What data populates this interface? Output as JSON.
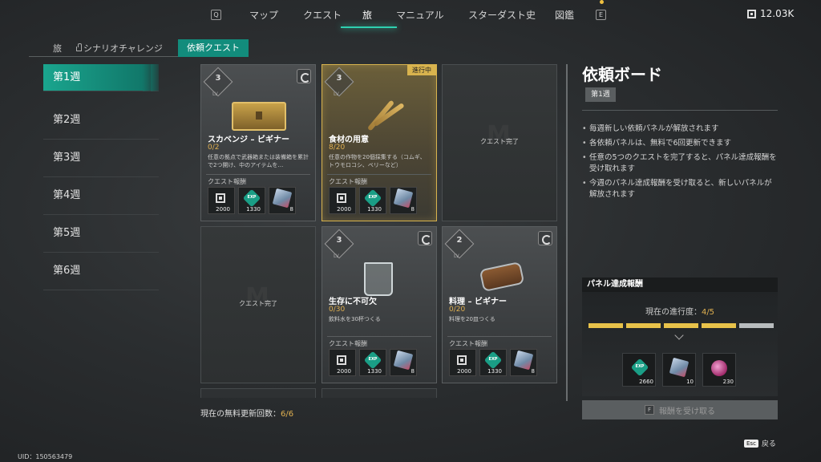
{
  "topnav": {
    "key_left": "Q",
    "key_right": "E",
    "items": [
      "マップ",
      "クエスト",
      "旅",
      "マニュアル",
      "スターダスト史",
      "図鑑"
    ],
    "active": "旅",
    "currency": "12.03K"
  },
  "breadcrumb": {
    "items": [
      "旅",
      "シナリオチャレンジ",
      "依頼クエスト"
    ],
    "active": "依頼クエスト"
  },
  "weeks": [
    "第1週",
    "第2週",
    "第3週",
    "第4週",
    "第5週",
    "第6週"
  ],
  "active_week": "第1週",
  "quests": [
    {
      "level": "3",
      "lv_label": "LV",
      "title": "スカベンジ – ビギナー",
      "progress": "0/2",
      "desc": "任意の拠点で武器箱または装備箱を累計で2つ開け、中のアイテムを…",
      "reward_label": "クエスト報酬",
      "rewards": [
        "2000",
        "1330",
        "8"
      ],
      "state": "available"
    },
    {
      "level": "3",
      "lv_label": "LV",
      "badge": "進行中",
      "title": "食材の用意",
      "progress": "8/20",
      "desc": "任意の作物を20個採集する（コムギ、トウモロコシ、ベリーなど）",
      "reward_label": "クエスト報酬",
      "rewards": [
        "2000",
        "1330",
        "8"
      ],
      "state": "in-progress"
    },
    {
      "done_text": "クエスト完了",
      "state": "done"
    },
    {
      "done_text": "クエスト完了",
      "state": "done"
    },
    {
      "level": "3",
      "lv_label": "LV",
      "title": "生存に不可欠",
      "progress": "0/30",
      "desc": "飲料水を30杯つくる",
      "reward_label": "クエスト報酬",
      "rewards": [
        "2000",
        "1330",
        "8"
      ],
      "state": "available"
    },
    {
      "level": "2",
      "lv_label": "LV",
      "title": "料理 – ビギナー",
      "progress": "0/20",
      "desc": "料理を20皿つくる",
      "reward_label": "クエスト報酬",
      "rewards": [
        "2000",
        "1330",
        "8"
      ],
      "state": "available"
    }
  ],
  "icons": {
    "reward_1": "pass-icon",
    "reward_2": "exp-icon",
    "reward_3": "crystal-cube-icon",
    "refresh": "refresh-icon",
    "exp_text": "EXP"
  },
  "free_refresh": {
    "label": "現在の無料更新回数：",
    "value": "6/6"
  },
  "board": {
    "title": "依頼ボード",
    "week": "第1週",
    "rules": [
      "毎週新しい依頼パネルが解放されます",
      "各依頼パネルは、無料で6回更新できます",
      "任意の5つのクエストを完了すると、パネル達成報酬を受け取れます",
      "今週のパネル達成報酬を受け取ると、新しいパネルが解放されます"
    ]
  },
  "panel_reward": {
    "title": "パネル達成報酬",
    "progress_label": "現在の進行度：",
    "progress_value": "4/5",
    "progress_fraction": 0.8,
    "rewards": [
      "2660",
      "10",
      "230"
    ]
  },
  "claim": {
    "key": "F",
    "label": "報酬を受け取る"
  },
  "esc": {
    "key": "Esc",
    "label": "戻る"
  },
  "uid": "UID：150563479",
  "colors": {
    "accent": "#1aa58e",
    "gold": "#d8b34e",
    "progress": "#e0b050"
  }
}
